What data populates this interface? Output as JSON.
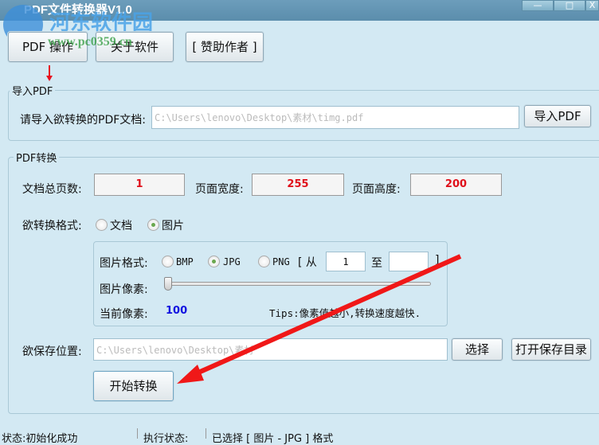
{
  "window": {
    "title": "PDF文件转换器V1.0",
    "minimize": "—",
    "maximize": "□",
    "close": "X"
  },
  "watermark": {
    "name": "河东软件园",
    "url": "www.pc0359.cn"
  },
  "toolbar": {
    "pdf_ops": "PDF 操作",
    "about": "关于软件",
    "sponsor": "[ 赞助作者 ]"
  },
  "import_group": {
    "title": "导入PDF",
    "label": "请导入欲转换的PDF文档:",
    "path": "C:\\Users\\lenovo\\Desktop\\素材\\timg.pdf",
    "button": "导入PDF"
  },
  "convert_group": {
    "title": "PDF转换",
    "total_pages_label": "文档总页数:",
    "total_pages": "1",
    "width_label": "页面宽度:",
    "width": "255",
    "height_label": "页面高度:",
    "height": "200",
    "format_label": "欲转换格式:",
    "format_doc": "文档",
    "format_img": "图片",
    "selected_format": "图片",
    "image": {
      "format_label": "图片格式:",
      "bmp": "BMP",
      "jpg": "JPG",
      "png": "PNG",
      "selected": "JPG",
      "range_open": "[ 从",
      "from": "1",
      "to_label": "至",
      "to": "",
      "range_close": "]",
      "pixel_label": "图片像素:",
      "slider_value": 0,
      "current_label": "当前像素:",
      "current": "100",
      "tips": "Tips:像素值越小,转换速度越快."
    },
    "save_label": "欲保存位置:",
    "save_path": "C:\\Users\\lenovo\\Desktop\\素材",
    "choose": "选择",
    "open_dir": "打开保存目录",
    "start": "开始转换"
  },
  "status": {
    "state": "状态:初始化成功",
    "exec": "执行状态:",
    "selected": "已选择 [ 图片 - JPG ] 格式"
  }
}
